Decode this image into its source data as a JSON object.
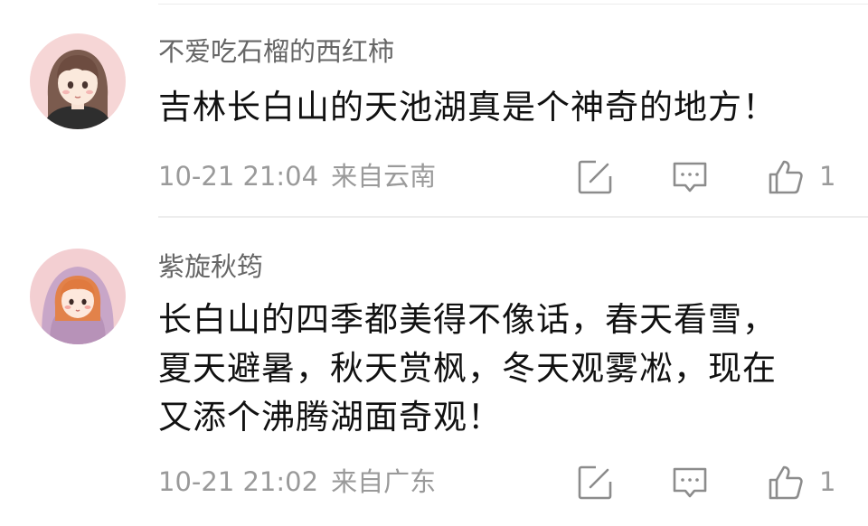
{
  "comments": [
    {
      "username": "不爱吃石榴的西红柿",
      "text_lines": [
        "吉林长白山的天池湖真是个神奇的地方！"
      ],
      "timestamp": "10-21 21:04",
      "location": "来自云南",
      "likes": "1",
      "avatar": "girl-with-bangs-avatar"
    },
    {
      "username": "紫旋秋筠",
      "text_lines": [
        "长白山的四季都美得不像话，春天看雪，",
        "夏天避暑，秋天赏枫，冬天观雾凇，现在",
        "又添个沸腾湖面奇观！"
      ],
      "timestamp": "10-21 21:02",
      "location": "来自广东",
      "likes": "1",
      "avatar": "girl-in-purple-hood-avatar"
    }
  ],
  "icons": {
    "edit": "edit-icon",
    "reply": "comment-icon",
    "like": "thumbs-up-icon"
  },
  "colors": {
    "username": "#666666",
    "text": "#111111",
    "meta": "#9a9a9a",
    "icon": "#8c8c8c"
  }
}
